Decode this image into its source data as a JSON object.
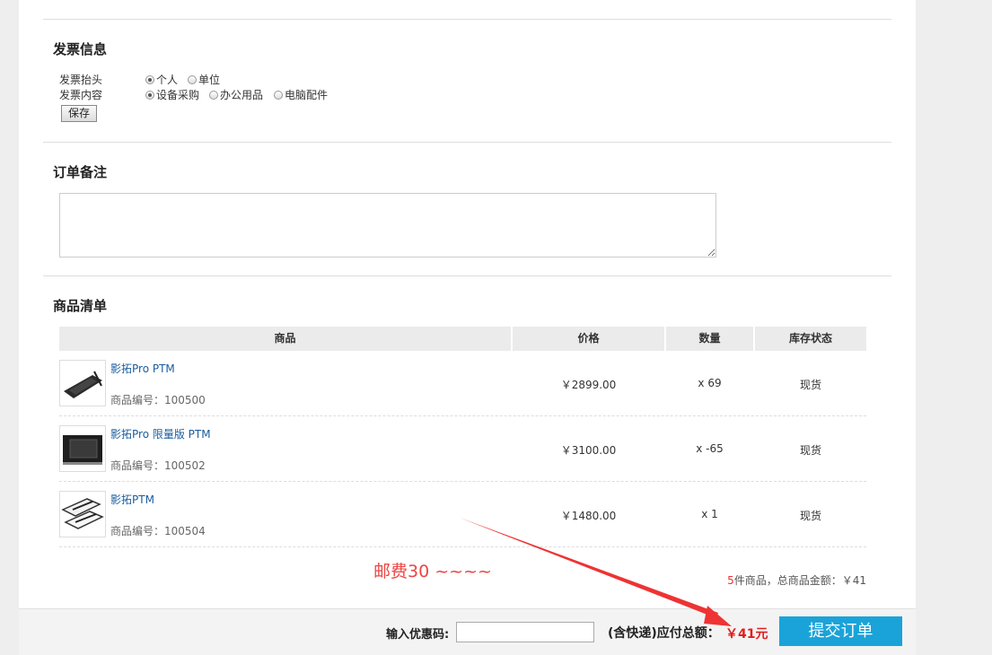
{
  "invoice": {
    "title": "发票信息",
    "header_label": "发票抬头",
    "header_options": [
      {
        "label": "个人",
        "checked": true
      },
      {
        "label": "单位",
        "checked": false
      }
    ],
    "content_label": "发票内容",
    "content_options": [
      {
        "label": "设备采购",
        "checked": true
      },
      {
        "label": "办公用品",
        "checked": false
      },
      {
        "label": "电脑配件",
        "checked": false
      }
    ],
    "save_label": "保存"
  },
  "remark": {
    "title": "订单备注",
    "value": ""
  },
  "products": {
    "title": "商品清单",
    "columns": [
      "商品",
      "价格",
      "数量",
      "库存状态"
    ],
    "rows": [
      {
        "name": "影拓Pro PTM",
        "code": "商品编号：100500",
        "price": "￥2899.00",
        "qty": "x 69",
        "stock": "现货",
        "image": "tablet-dark-icon"
      },
      {
        "name": "影拓Pro 限量版 PTM",
        "code": "商品编号：100502",
        "price": "￥3100.00",
        "qty": "x -65",
        "stock": "现货",
        "image": "tablet-box-icon"
      },
      {
        "name": "影拓PTM",
        "code": "商品编号：100504",
        "price": "￥1480.00",
        "qty": "x 1",
        "stock": "现货",
        "image": "tablet-white-icon"
      }
    ],
    "summary_count": "5",
    "summary_text": "件商品，总商品金额：￥41"
  },
  "annotation": {
    "text": "邮费30 ~~~~",
    "color": "#ee4444"
  },
  "footer": {
    "coupon_label": "输入优惠码:",
    "coupon_value": "",
    "total_label": "(含快递)应付总额：",
    "total_value": "￥41元",
    "submit_label": "提交订单",
    "accent": "#1aa3d9"
  }
}
